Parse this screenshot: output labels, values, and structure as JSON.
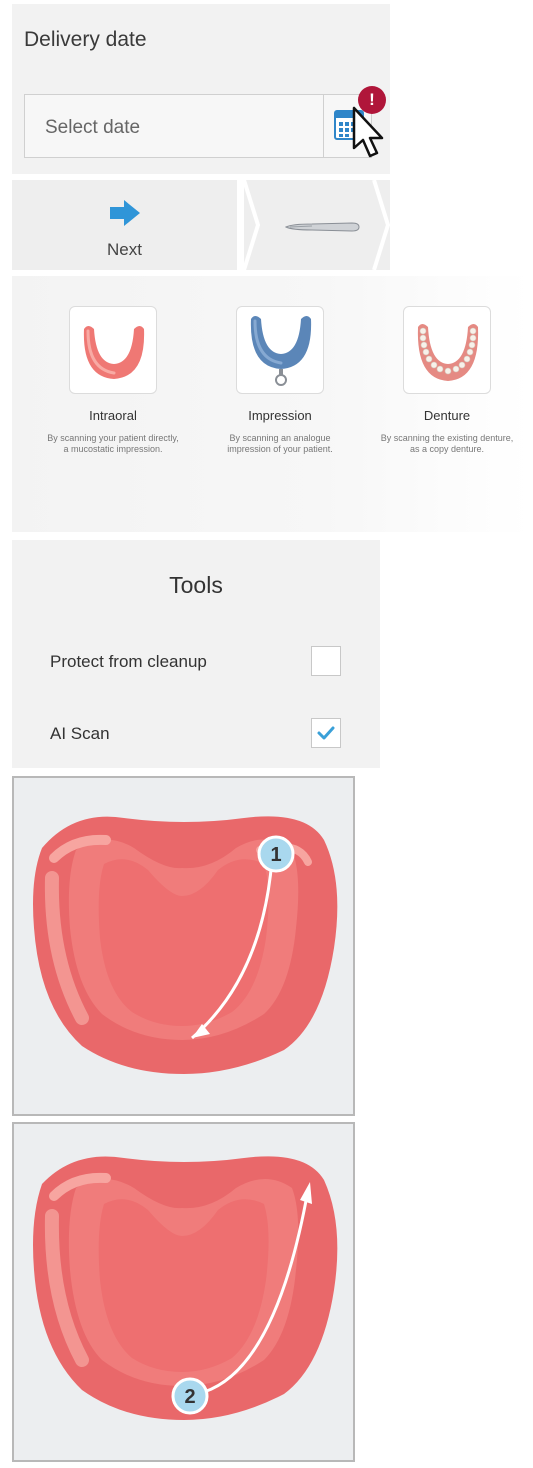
{
  "delivery": {
    "title": "Delivery date",
    "placeholder": "Select date",
    "badge": "!",
    "icons": {
      "calendar": "calendar-icon",
      "warning": "alert-badge",
      "cursor": "cursor-pointer"
    }
  },
  "navigation": {
    "next_label": "Next",
    "icons": {
      "next": "arrow-right-icon",
      "scanner": "scanner-wand-icon"
    },
    "accent": "#3498db"
  },
  "scan_types": [
    {
      "name": "Intraoral",
      "desc": [
        "By scanning your patient directly,",
        "a mucostatic impression."
      ],
      "icon": "intraoral-arch-icon"
    },
    {
      "name": "Impression",
      "desc": [
        "By scanning an analogue",
        "impression of your patient."
      ],
      "icon": "impression-tray-icon"
    },
    {
      "name": "Denture",
      "desc": [
        "By scanning the existing denture,",
        "as a copy denture."
      ],
      "icon": "denture-icon"
    }
  ],
  "tools": {
    "title": "Tools",
    "items": [
      {
        "label": "Protect from cleanup",
        "checked": false
      },
      {
        "label": "AI Scan",
        "checked": true
      }
    ],
    "check_color": "#3aa0d8"
  },
  "guides": [
    {
      "step": "1",
      "icon": "scan-path-step-1"
    },
    {
      "step": "2",
      "icon": "scan-path-step-2"
    }
  ],
  "colors": {
    "gum": "#ea6e6c",
    "gum_light": "#f49b94",
    "tray_blue": "#5b86b8",
    "badge": "#b0163a",
    "step_circle": "#a9d8ee"
  }
}
